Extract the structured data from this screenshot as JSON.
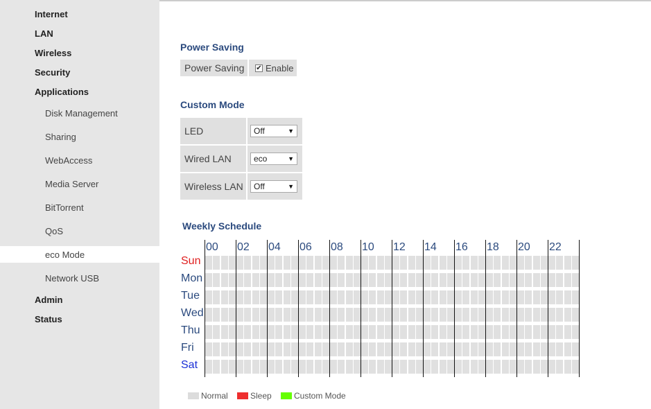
{
  "sidebar": {
    "items": [
      {
        "label": "Internet",
        "level": "top"
      },
      {
        "label": "LAN",
        "level": "top"
      },
      {
        "label": "Wireless",
        "level": "top"
      },
      {
        "label": "Security",
        "level": "top"
      },
      {
        "label": "Applications",
        "level": "top"
      },
      {
        "label": "Disk Management",
        "level": "sub"
      },
      {
        "label": "Sharing",
        "level": "sub"
      },
      {
        "label": "WebAccess",
        "level": "sub"
      },
      {
        "label": "Media Server",
        "level": "sub"
      },
      {
        "label": "BitTorrent",
        "level": "sub"
      },
      {
        "label": "QoS",
        "level": "sub"
      },
      {
        "label": "eco Mode",
        "level": "sub",
        "active": true
      },
      {
        "label": "Network USB",
        "level": "sub"
      },
      {
        "label": "Admin",
        "level": "top"
      },
      {
        "label": "Status",
        "level": "top"
      }
    ]
  },
  "power_saving": {
    "title": "Power Saving",
    "row_label": "Power Saving",
    "enable_label": "Enable",
    "enabled": true,
    "check_glyph": "✔"
  },
  "custom_mode": {
    "title": "Custom Mode",
    "rows": [
      {
        "label": "LED",
        "value": "Off"
      },
      {
        "label": "Wired LAN",
        "value": "eco"
      },
      {
        "label": "Wireless LAN",
        "value": "Off"
      }
    ],
    "arrow_glyph": "▼"
  },
  "schedule": {
    "title": "Weekly Schedule",
    "hours": [
      "00",
      "02",
      "04",
      "06",
      "08",
      "10",
      "12",
      "14",
      "16",
      "18",
      "20",
      "22"
    ],
    "days": [
      {
        "label": "Sun",
        "color": "#e02020"
      },
      {
        "label": "Mon",
        "color": "#2b4a7e"
      },
      {
        "label": "Tue",
        "color": "#2b4a7e"
      },
      {
        "label": "Wed",
        "color": "#2b4a7e"
      },
      {
        "label": "Thu",
        "color": "#2b4a7e"
      },
      {
        "label": "Fri",
        "color": "#2b4a7e"
      },
      {
        "label": "Sat",
        "color": "#1a2fd6"
      }
    ],
    "slots_per_day": 48
  },
  "legend": [
    {
      "label": "Normal",
      "color": "#dcdcdc"
    },
    {
      "label": "Sleep",
      "color": "#ee2e2e"
    },
    {
      "label": "Custom Mode",
      "color": "#66ff00"
    }
  ]
}
